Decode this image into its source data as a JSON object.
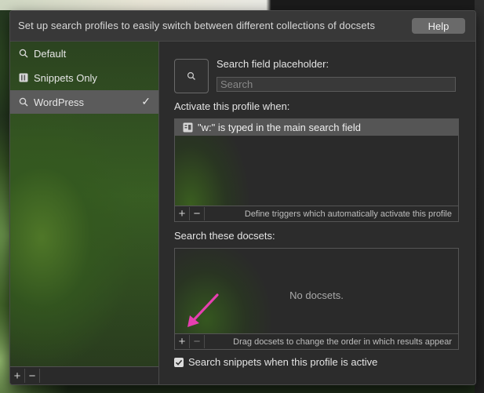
{
  "header": {
    "description": "Set up search profiles to easily switch between different collections of docsets",
    "help_label": "Help"
  },
  "profiles": [
    {
      "label": "Default",
      "icon": "search-icon",
      "selected": false
    },
    {
      "label": "Snippets Only",
      "icon": "snippet-icon",
      "selected": false
    },
    {
      "label": "WordPress",
      "icon": "search-icon",
      "selected": true
    }
  ],
  "sidebar_footer": {
    "add": "+",
    "remove": "−"
  },
  "placeholder_section": {
    "label": "Search field placeholder:",
    "placeholder": "Search"
  },
  "activate_section": {
    "label": "Activate this profile when:",
    "triggers": [
      "\"w:\" is typed in the main search field"
    ],
    "footer_text": "Define triggers which automatically activate this profile",
    "add": "+",
    "remove": "−"
  },
  "docsets_section": {
    "label": "Search these docsets:",
    "empty_text": "No docsets.",
    "footer_text": "Drag docsets to change the order in which results appear",
    "add": "+",
    "remove": "−"
  },
  "snippets_option": {
    "label": "Search snippets when this profile is active",
    "checked": true
  },
  "colors": {
    "selected_row": "#5b5b5b",
    "annotation_arrow": "#e63fb0"
  }
}
